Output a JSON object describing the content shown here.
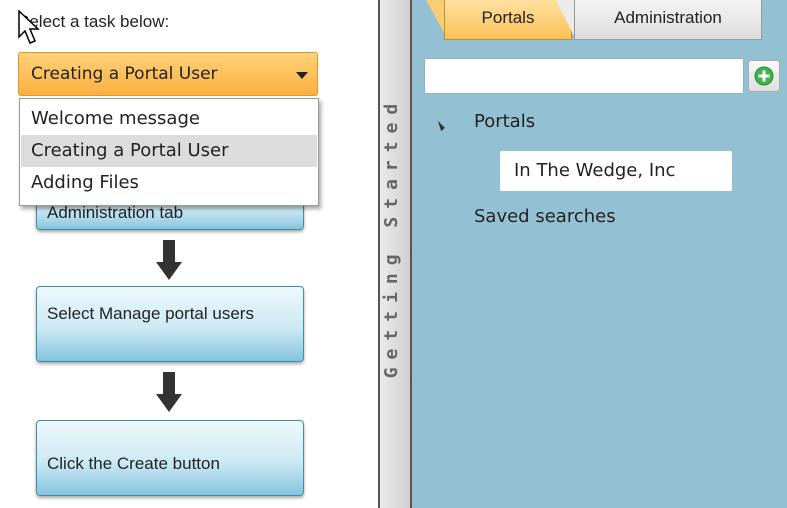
{
  "left": {
    "prompt": "Select a task below:",
    "combo_value": "Creating a Portal User",
    "dropdown_options": [
      "Welcome message",
      "Creating a Portal User",
      "Adding Files"
    ],
    "selected_option_index": 1,
    "steps": [
      "Administration tab",
      "Select Manage portal users",
      "Click the Create button"
    ]
  },
  "sidebar": {
    "label": "Getting Started"
  },
  "right": {
    "tabs": [
      "Portals",
      "Administration"
    ],
    "search_value": "",
    "tree": {
      "root_label": "Portals",
      "child_label": "In The Wedge, Inc",
      "saved_label": "Saved searches"
    }
  },
  "icons": {
    "cursor": "mouse-pointer-icon",
    "arrow": "down-arrow-icon",
    "add": "add-icon",
    "caret": "expanded-caret-icon"
  },
  "colors": {
    "combo": "#fbb040",
    "step_border": "#3b8fb1",
    "right_panel": "#93c0d3",
    "tab_active": "#fbc257",
    "add_green": "#3fb34f"
  }
}
